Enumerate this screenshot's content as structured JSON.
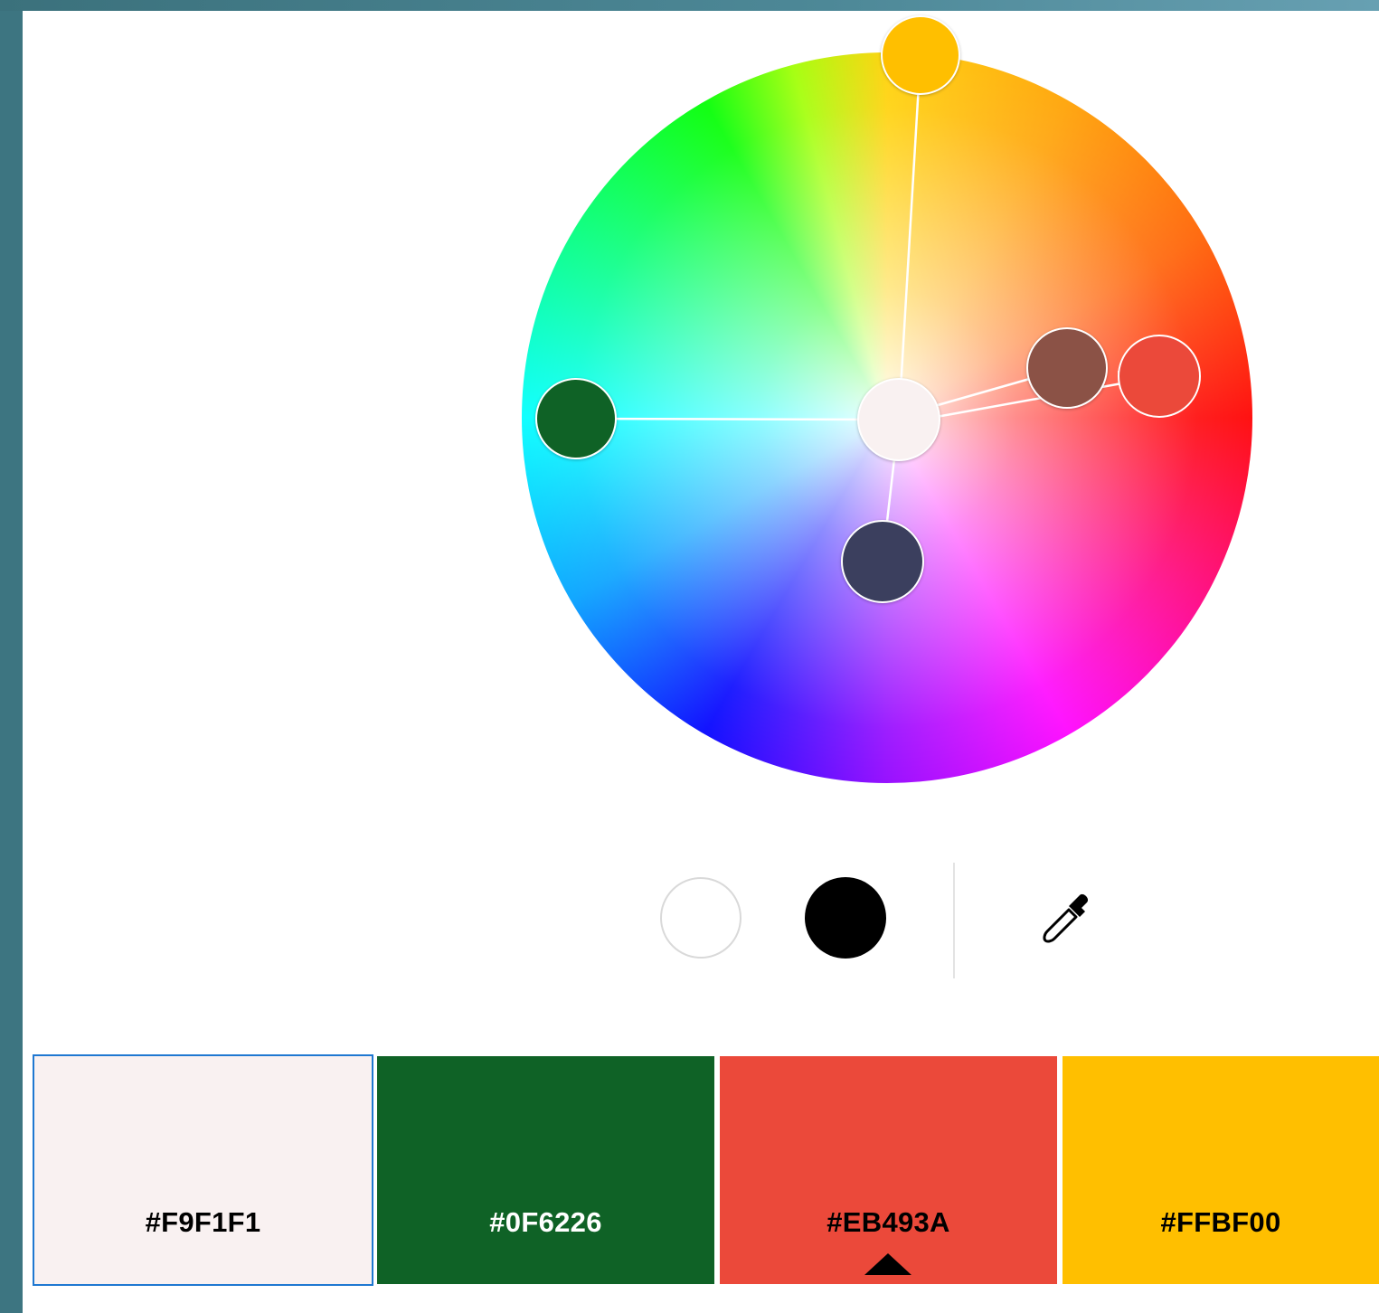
{
  "app": {
    "accent_color": "#1f78d1",
    "frame_color": "#3d7581"
  },
  "wheel": {
    "handles": [
      {
        "name": "base",
        "color": "#F9F1F1"
      },
      {
        "name": "yellow",
        "color": "#FFBF00"
      },
      {
        "name": "green",
        "color": "#0F6226"
      },
      {
        "name": "navy",
        "color": "#3B3F5E"
      },
      {
        "name": "brown",
        "color": "#8B5246"
      },
      {
        "name": "red",
        "color": "#EB493A"
      }
    ]
  },
  "toolbar": {
    "white_color": "#FFFFFF",
    "black_color": "#000000",
    "eyedropper_icon": "eyedropper-icon"
  },
  "palette": {
    "swatches": [
      {
        "hex": "#F9F1F1",
        "color": "#F9F1F1",
        "text_color": "#000000",
        "selected": true
      },
      {
        "hex": "#0F6226",
        "color": "#0F6226",
        "text_color": "#FFFFFF",
        "selected": false
      },
      {
        "hex": "#EB493A",
        "color": "#EB493A",
        "text_color": "#000000",
        "selected": false
      },
      {
        "hex": "#FFBF00",
        "color": "#FFBF00",
        "text_color": "#000000",
        "selected": false
      }
    ]
  }
}
